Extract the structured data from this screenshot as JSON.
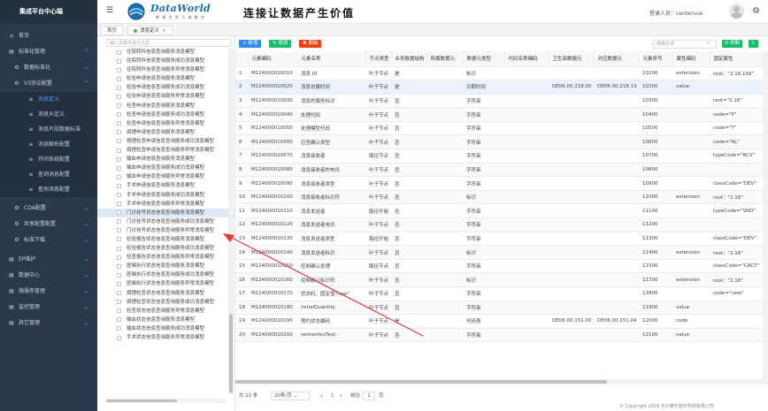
{
  "app": {
    "title": "集成平台中心端"
  },
  "sidebar": {
    "items": [
      {
        "icon": "home-icon",
        "glyph": "⌂",
        "label": "首页",
        "level": 1
      },
      {
        "icon": "stack-icon",
        "glyph": "▤",
        "label": "标准化管理",
        "level": 1,
        "open": true
      },
      {
        "icon": "gear-icon",
        "glyph": "⚙",
        "label": "数据标准化",
        "level": 2
      },
      {
        "icon": "gear-icon",
        "glyph": "⚙",
        "label": "V3协议配置",
        "level": 2,
        "open": true
      },
      {
        "icon": "bars-icon",
        "glyph": "≡",
        "label": "消息定义",
        "level": 3,
        "active": true
      },
      {
        "icon": "bars-icon",
        "glyph": "≡",
        "label": "消息头定义",
        "level": 3
      },
      {
        "icon": "bars-icon",
        "glyph": "≡",
        "label": "消息片段数据标准",
        "level": 3
      },
      {
        "icon": "bars-icon",
        "glyph": "≡",
        "label": "消息解析配置",
        "level": 3
      },
      {
        "icon": "bars-icon",
        "glyph": "≡",
        "label": "开闭系统配置",
        "level": 3
      },
      {
        "icon": "bars-icon",
        "glyph": "≡",
        "label": "查询消息配置",
        "level": 3
      },
      {
        "icon": "bars-icon",
        "glyph": "≡",
        "label": "查询消息配置",
        "level": 3
      },
      {
        "icon": "gear-icon",
        "glyph": "⚙",
        "label": "CDA配置",
        "level": 2
      },
      {
        "icon": "gear-icon",
        "glyph": "⚙",
        "label": "共享配置配置",
        "level": 2
      },
      {
        "icon": "gear-icon",
        "glyph": "⚙",
        "label": "标准下载",
        "level": 2
      },
      {
        "icon": "stack-icon",
        "glyph": "▤",
        "label": "EP维护",
        "level": 1
      },
      {
        "icon": "stack-icon",
        "glyph": "▤",
        "label": "数据中心",
        "level": 1
      },
      {
        "icon": "stack-icon",
        "glyph": "▤",
        "label": "微服务管理",
        "level": 1
      },
      {
        "icon": "stack-icon",
        "glyph": "▤",
        "label": "监控管理",
        "level": 1
      },
      {
        "icon": "stack-icon",
        "glyph": "▤",
        "label": "其它管理",
        "level": 1
      }
    ]
  },
  "header": {
    "menu_glyph": "☰",
    "logo_word": "DataWorld",
    "logo_sub": "数 据 世 界 万 维 数 字",
    "slogan": "连接让数据产生价值",
    "login_text": "登录人员：centervue",
    "gear_glyph": "⚙"
  },
  "tabs": [
    {
      "label": "首页",
      "active": false
    },
    {
      "label": "消息定义",
      "active": true
    }
  ],
  "tree": {
    "search_placeholder": "输入关键字进行过滤",
    "rows": [
      "住院转科信息查询服务消息模型",
      "住院转科信息查询服务成功消息模型",
      "住院转科信息查询服务异常消息模型",
      "检验申请信息查询服务消息模型",
      "检验申请信息查询服务成功消息模型",
      "检验申请信息查询服务异常消息模型",
      "检查申请信息查询服务消息模型",
      "检查申请信息查询服务成功消息模型",
      "检查申请信息查询服务异常消息模型",
      "病理申请信息查询服务消息模型",
      "病理检查申请信息查询服务成功消息模型",
      "病理检查申请信息查询服务异常消息模型",
      "输血申请信息查询服务消息模型",
      "输血申请信息查询服务成功消息模型",
      "输血申请信息查询服务异常消息模型",
      "手术申请信息查询服务消息模型",
      "手术申请信息查询服务成功消息模型",
      "手术申请信息查询服务异常消息模型",
      "门诊挂号状态信息查询服务消息模型",
      "门诊挂号状态信息查询服务成功消息模型",
      "门诊挂号状态信息查询服务异常消息模型",
      "检验报告状态信息查询服务消息模型",
      "检验报告状态信息查询服务成功消息模型",
      "检查报告状态信息查询服务异常消息模型",
      "医嘱执行状态信息查询服务消息模型",
      "医嘱执行状态信息查询服务成功消息模型",
      "医嘱执行状态信息查询服务异常消息模型",
      "病理检查状态信息查询服务消息模型",
      "病理检查状态信息查询服务成功消息模型",
      "检查状态信息查询服务异常消息模型",
      "输血状态信息查询服务消息模型",
      "输血状态信息查询服务成功消息模型",
      "手术状态信息查询服务异常消息模型"
    ],
    "selected_index": 18
  },
  "toolbar": {
    "add_label": "+ 新增",
    "edit_label": "✎ 修改",
    "delete_label": "✖ 删除",
    "search_placeholder": "模糊名称",
    "refresh_label": "⟳ 刷新",
    "export_label": "⇩"
  },
  "table": {
    "columns": [
      "",
      "元素编码",
      "元素名称",
      "节点类型",
      "业务数据结构",
      "所属数据元",
      "数据元类型",
      "代码名称编码",
      "卫生部数据元",
      "对应数据元",
      "元素序号",
      "属性编码",
      "固定属性"
    ],
    "rows": [
      [
        "1",
        "M124000010010",
        "消息 ID",
        "叶子节点",
        "是",
        "",
        "标识",
        "",
        "",
        "",
        "10100",
        "extension",
        "root：\"2.16.156\""
      ],
      [
        "2",
        "M124000010020",
        "消息创建时间",
        "叶子节点",
        "是",
        "",
        "日期时间",
        "",
        "DE06.00.218.00",
        "DE06.00.218.13",
        "10200",
        "value",
        ""
      ],
      [
        "3",
        "M124000010030",
        "消息的服务标识",
        "叶子节点",
        "否",
        "",
        "字符串",
        "",
        "",
        "",
        "10300",
        "",
        "root=\"2.16\""
      ],
      [
        "4",
        "M124000010040",
        "处理代码",
        "叶子节点",
        "否",
        "",
        "字符串",
        "",
        "",
        "",
        "10400",
        "",
        "code=\"P\""
      ],
      [
        "5",
        "M124000010050",
        "处理模型代码",
        "叶子节点",
        "否",
        "",
        "字符串",
        "",
        "",
        "",
        "10500",
        "",
        "code=\"T\""
      ],
      [
        "6",
        "M124000010060",
        "应答确认类型",
        "叶子节点",
        "否",
        "",
        "字符串",
        "",
        "",
        "",
        "10600",
        "",
        "code=\"AL\""
      ],
      [
        "7",
        "M124000010070",
        "消息接收者",
        "路径节点",
        "否",
        "",
        "字符串",
        "",
        "",
        "",
        "10700",
        "",
        "typeCode=\"RCV\""
      ],
      [
        "8",
        "M124000010080",
        "消息接收者的电讯",
        "叶子节点",
        "否",
        "",
        "字符串",
        "",
        "",
        "",
        "10800",
        "",
        ""
      ],
      [
        "9",
        "M124000010090",
        "消息接收者类型",
        "叶子节点",
        "否",
        "",
        "字符串",
        "",
        "",
        "",
        "10900",
        "",
        "classCode=\"DEV\""
      ],
      [
        "10",
        "M124000010100",
        "消息接收者标识符",
        "叶子节点",
        "否",
        "",
        "标识",
        "",
        "",
        "",
        "11000",
        "extension",
        "root：\"2.16\""
      ],
      [
        "11",
        "M124000010110",
        "消息发送者",
        "路径开始",
        "否",
        "",
        "字符串",
        "",
        "",
        "",
        "11100",
        "",
        "typeCode=\"SND\""
      ],
      [
        "12",
        "M124000010120",
        "消息发送者电讯",
        "叶子节点",
        "否",
        "",
        "字符串",
        "",
        "",
        "",
        "11200",
        "",
        ""
      ],
      [
        "13",
        "M124000010130",
        "消息发送者类型",
        "路径开始",
        "否",
        "",
        "字符串",
        "",
        "",
        "",
        "11300",
        "",
        "classCode=\"DEV\""
      ],
      [
        "14",
        "M124000010140",
        "消息发送者标识",
        "叶子节点",
        "否",
        "",
        "标识",
        "",
        "",
        "",
        "11400",
        "extension",
        "root：\"2.16\""
      ],
      [
        "15",
        "M124000010150",
        "控制确认处理",
        "路径节点",
        "否",
        "",
        "字符串",
        "",
        "",
        "",
        "11500",
        "",
        "classCode=\"CACT\""
      ],
      [
        "16",
        "M124000010160",
        "控制确认标识符",
        "叶子节点",
        "否",
        "",
        "标识",
        "",
        "",
        "",
        "11700",
        "extension",
        "root：\"2.16\""
      ],
      [
        "17",
        "M124000010170",
        "状态码，固定值\"new\"",
        "叶子节点",
        "否",
        "",
        "字符串",
        "",
        "",
        "",
        "11800",
        "",
        "code=\"new\""
      ],
      [
        "18",
        "M124000010180",
        "initialQuantity",
        "叶子节点",
        "否",
        "",
        "字符串",
        "",
        "",
        "",
        "11900",
        "value",
        ""
      ],
      [
        "19",
        "M124000010190",
        "预约状态编码",
        "叶子节点",
        "是",
        "",
        "代码表",
        "",
        "DE06.00.151.00",
        "DE06.00.151.04",
        "12000",
        "code",
        ""
      ],
      [
        "20",
        "M124000010200",
        "semanticsText",
        "叶子节点",
        "否",
        "",
        "字符串",
        "",
        "",
        "",
        "12100",
        "value",
        ""
      ]
    ],
    "selected_row": 1
  },
  "pager": {
    "total": "共 22 条",
    "page_size": "20条/页",
    "prev": "‹",
    "next": "›",
    "goto_label": "前往",
    "page_input": "1",
    "page_unit": "页"
  },
  "copyright": "© Copyright 2018 长沙康乐软件科技有限公司",
  "colors": {
    "sidebar_bg": "#2b3a4a",
    "accent": "#2f8cf0",
    "active_nav": "#4aa3ff",
    "arrow": "#e8393d"
  }
}
